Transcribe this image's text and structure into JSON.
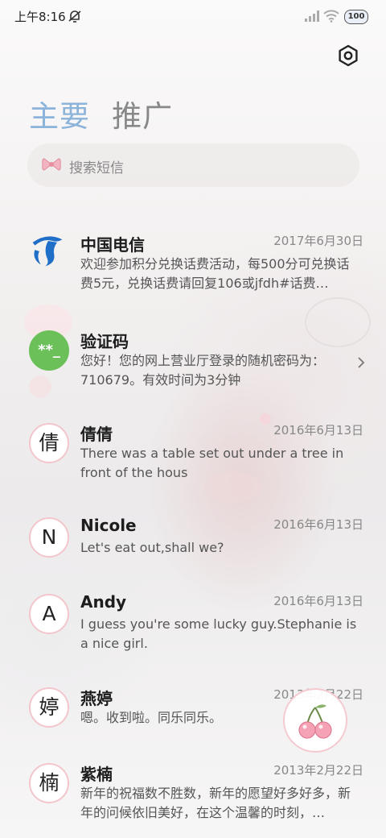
{
  "status": {
    "time": "上午8:16",
    "battery": "100"
  },
  "tabs": {
    "main": "主要",
    "promo": "推广"
  },
  "search": {
    "placeholder": "搜索短信"
  },
  "messages": [
    {
      "sender": "中国电信",
      "date": "2017年6月30日",
      "preview": "欢迎参加积分兑换话费活动，每500分可兑换话费5元，兑换话费请回复106或jfdh#话费…",
      "avatar": "telecom-logo"
    },
    {
      "sender": "验证码",
      "date": "",
      "preview": "您好！您的网上营业厅登录的随机密码为：710679。有效时间为3分钟",
      "avatar": "**_"
    },
    {
      "sender": "倩倩",
      "date": "2016年6月13日",
      "preview": "There was a table set out under a tree in front of the hous",
      "avatar": "倩"
    },
    {
      "sender": "Nicole",
      "date": "2016年6月13日",
      "preview": "Let's eat out,shall we?",
      "avatar": "N"
    },
    {
      "sender": "Andy",
      "date": "2016年6月13日",
      "preview": "I guess you're some lucky guy.Stephanie is a nice girl.",
      "avatar": "A"
    },
    {
      "sender": "燕婷",
      "date": "2013年2月22日",
      "preview": "嗯。收到啦。同乐同乐。",
      "avatar": "婷"
    },
    {
      "sender": "紫楠",
      "date": "2013年2月22日",
      "preview": "新年的祝福数不胜数，新年的愿望好多好多，新年的问候依旧美好，在这个温馨的时刻，…",
      "avatar": "楠"
    }
  ],
  "colors": {
    "accent_tab": "#8cb3d9",
    "verify_green": "#6bc05a",
    "telecom_blue": "#1f6ec8",
    "avatar_ring": "#f3c6cc"
  },
  "icons": {
    "settings": "hexagon-gear-icon",
    "search": "bow-icon",
    "fab": "cherry-icon"
  }
}
